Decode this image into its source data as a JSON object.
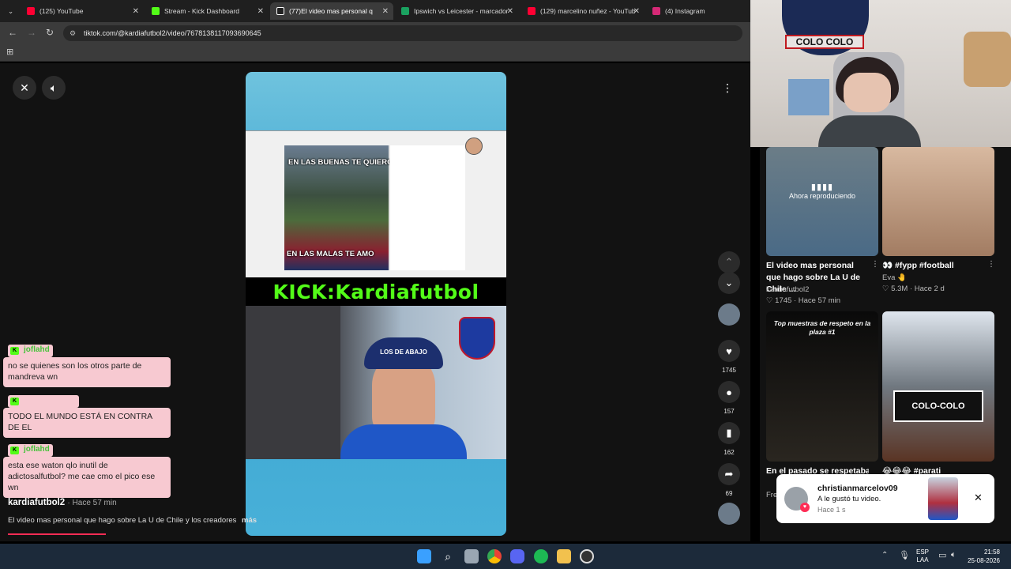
{
  "browser": {
    "tabs": [
      {
        "label": "(125) YouTube",
        "color": "#ff0033"
      },
      {
        "label": "Stream - Kick Dashboard",
        "color": "#53fc18"
      },
      {
        "label": "(77)El video mas personal q",
        "color": "#ffffff"
      },
      {
        "label": "Ipswich vs Leicester - marcador",
        "color": "#1aa260"
      },
      {
        "label": "(129) marcelino nuñez - YouTub",
        "color": "#ff0033"
      },
      {
        "label": "(4) Instagram",
        "color": "#d62976"
      }
    ],
    "url": "tiktok.com/@kardiafutbol2/video/7678138117093690645"
  },
  "video": {
    "top_text": "EN LAS BUENAS TE QUIERO",
    "bottom_text": "EN LAS MALAS TE AMO",
    "kick_banner": "KICK:Kardiafutbol",
    "cap_text": "LOS DE ABAJO"
  },
  "actions": {
    "likes": "1745",
    "comments": "157",
    "saves": "162",
    "shares": "69"
  },
  "chat": [
    {
      "user": "joflahd",
      "message": "no se quienes son los otros parte de mandreva wn"
    },
    {
      "user": "",
      "message": "TODO EL MUNDO ESTÁ EN CONTRA DE EL"
    },
    {
      "user": "joflahd",
      "message": "esta ese waton qlo inutil de adictosalfutbol? me cae cmo el pico ese wn"
    }
  ],
  "author": {
    "name": "kardiafutbol2",
    "time": "Hace 57 min",
    "description": "El video mas personal que hago sobre La U de Chile y los creadores",
    "more": "más"
  },
  "panel": {
    "now_playing": "Ahora reproduciendo",
    "cards": [
      {
        "title": "El video mas personal que hago sobre La U de Chile ...",
        "author": "kardiafutbol2",
        "stats": "1745 · Hace 57 min"
      },
      {
        "title": "👀 #fypp #football",
        "author": "Eva 🤚",
        "stats": "5.3M · Hace 2 d"
      },
      {
        "title": "En el pasado se respetaban",
        "author": "Fre",
        "thumb_text": "Top muestras de respeto en la plaza #1"
      },
      {
        "title": "😂😂😂 #parati",
        "author": "",
        "thumb_text": "COLO-COLO"
      }
    ]
  },
  "notification": {
    "user": "christianmarcelov09",
    "message": "A le gustó tu video.",
    "time": "Hace 1 s"
  },
  "webcam_overlay": {
    "banner": "COLO COLO"
  },
  "taskbar": {
    "lang": "ESP",
    "lang2": "LAA",
    "time": "21:58",
    "date": "25-08-2026"
  }
}
